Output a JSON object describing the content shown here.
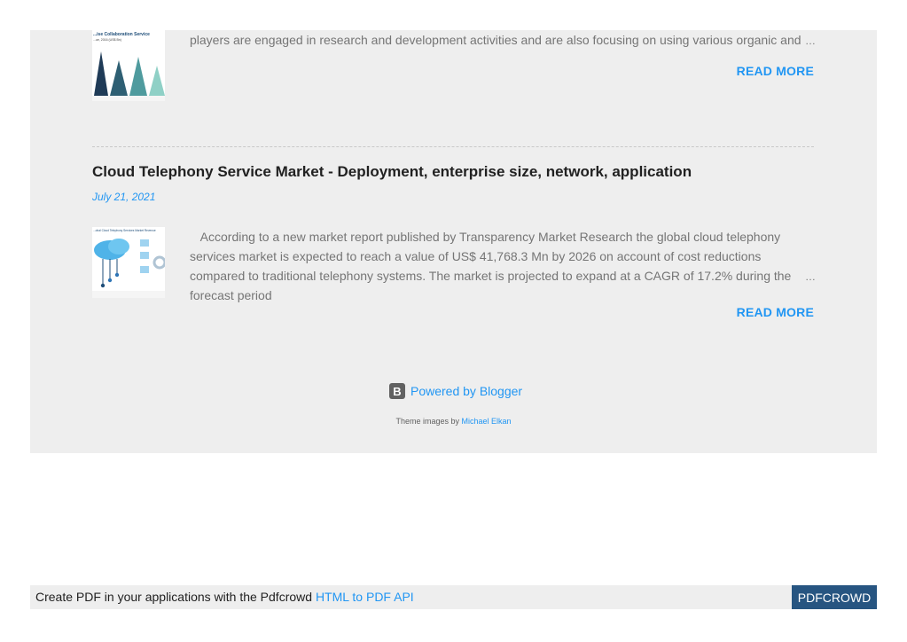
{
  "posts": [
    {
      "thumbnail_icon": "collaboration-services-infographic",
      "thumbnail_title": "...ise Collaboration Service",
      "thumbnail_subtitle": "...ue, 2016 (US$ Bn)",
      "snippet": "players are engaged in research and development activities and are also focusing on using various organic and",
      "ellipsis": "…",
      "read_more": "READ MORE"
    },
    {
      "title": "Cloud Telephony Service Market - Deployment, enterprise size, network, application",
      "date": "July 21, 2021",
      "thumbnail_icon": "cloud-telephony-infographic",
      "thumbnail_title": "...obal Cloud Telephony Services Market Revenue",
      "snippet": "According to a new market report published by Transparency Market Research  the  global cloud telephony services market  is expected to reach a value of US$ 41,768.3 Mn by 2026 on account of cost reductions compared to traditional telephony systems. The market is projected to expand at a CAGR of 17.2% during the forecast period",
      "ellipsis": "…",
      "read_more": "READ MORE"
    }
  ],
  "footer": {
    "powered_by": "Powered by Blogger",
    "powered_icon": "blogger-icon",
    "theme_prefix": "Theme images by",
    "theme_author": "Michael Elkan"
  },
  "pdf_bar": {
    "text": "Create PDF in your applications with the Pdfcrowd",
    "link": "HTML to PDF API",
    "brand": "PDFCROWD"
  },
  "colors": {
    "accent": "#2196f3",
    "panel_bg": "#eeeeee",
    "pdf_brand_bg": "#275581"
  }
}
